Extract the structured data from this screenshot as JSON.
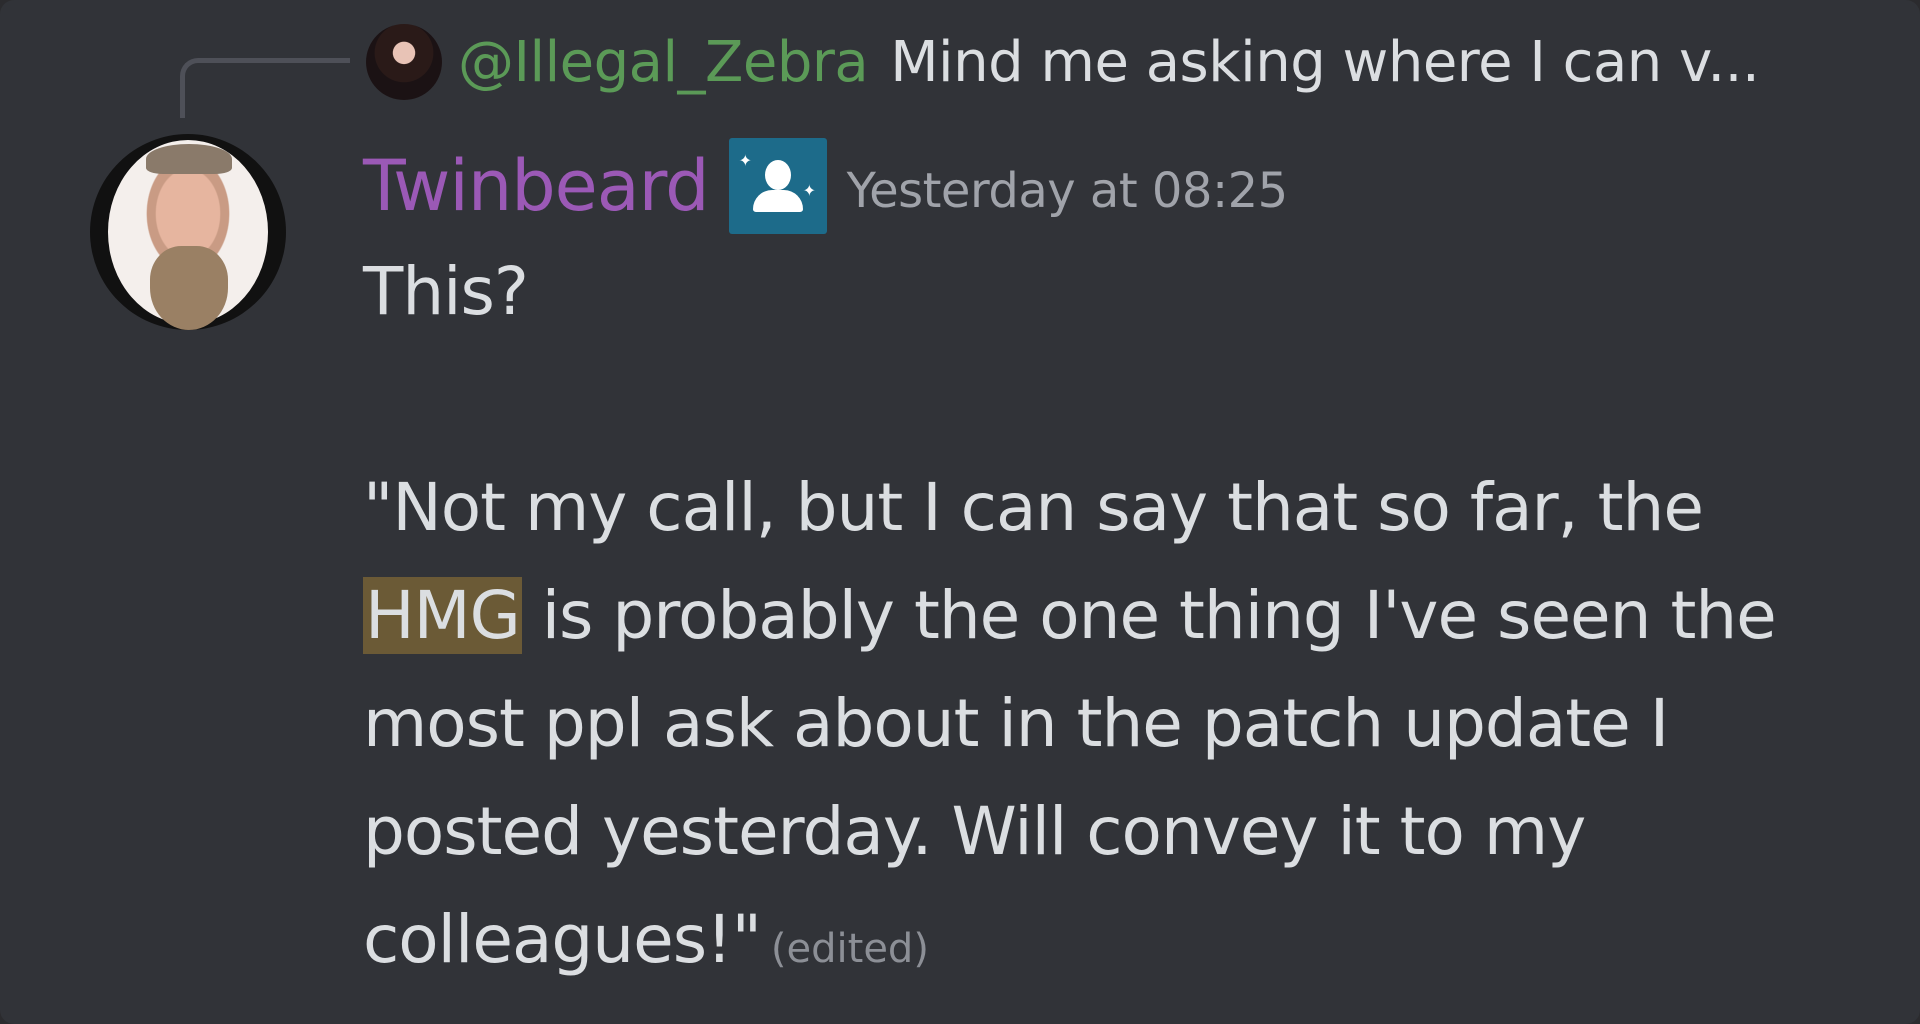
{
  "reply": {
    "username": "@Illegal_Zebra",
    "preview": "Mind me asking where I can v..."
  },
  "message": {
    "author": "Twinbeard",
    "timestamp": "Yesterday at 08:25",
    "lines": {
      "l1": "This?",
      "l2": "\"Not my call, but I can say that so far, the",
      "l3_highlight": "HMG",
      "l3_rest": " is probably the one thing I've seen the",
      "l4": "most ppl ask about in the patch update I",
      "l5": "posted yesterday. Will convey it to my",
      "l6": "colleagues!\""
    },
    "edited_label": "(edited)"
  },
  "colors": {
    "background": "#313338",
    "reply_username": "#5b9a57",
    "author": "#9b59b6",
    "text": "#dbdee1",
    "highlight": "#6b5a36",
    "role_badge": "#1d6b8a"
  },
  "icons": {
    "role_badge": "role-badge-icon"
  }
}
